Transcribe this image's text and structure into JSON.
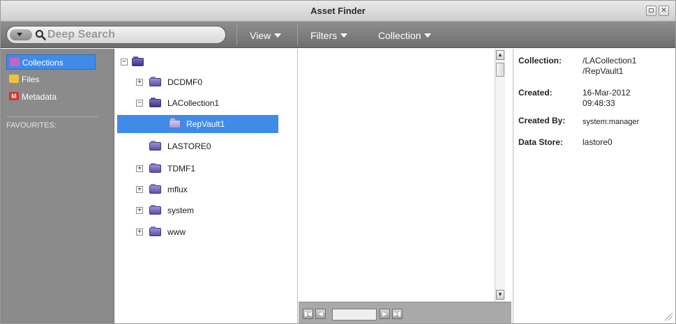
{
  "window": {
    "title": "Asset Finder"
  },
  "toolbar": {
    "search_placeholder": "Deep Search",
    "menus": [
      "View",
      "Filters",
      "Collection"
    ]
  },
  "sidebar": {
    "items": [
      {
        "label": "Collections",
        "icon": "collections-icon",
        "active": true
      },
      {
        "label": "Files",
        "icon": "folder-icon",
        "active": false
      },
      {
        "label": "Metadata",
        "icon": "metadata-icon",
        "active": false
      }
    ],
    "section_label": "FAVOURITES:"
  },
  "tree": {
    "nodes": [
      {
        "label": "DCDMF0",
        "expander": "+"
      },
      {
        "label": "LACollection1",
        "expander": "−"
      },
      {
        "label": "RepVault1",
        "expander": "",
        "selected": true
      },
      {
        "label": "LASTORE0",
        "expander": ""
      },
      {
        "label": "TDMF1",
        "expander": "+"
      },
      {
        "label": "mflux",
        "expander": "+"
      },
      {
        "label": "system",
        "expander": "+"
      },
      {
        "label": "www",
        "expander": "+"
      }
    ]
  },
  "details": {
    "collection_label": "Collection:",
    "collection_value_1": "/LACollection1",
    "collection_value_2": "/RepVault1",
    "created_label": "Created:",
    "created_value_1": "16-Mar-2012",
    "created_value_2": "09:48:33",
    "created_by_label": "Created By:",
    "created_by_value": "system:manager",
    "data_store_label": "Data Store:",
    "data_store_value": "lastore0"
  },
  "colors": {
    "selection": "#3f8be8",
    "toolbar": "#7e7e7e",
    "sidebar": "#8b8b8b"
  }
}
